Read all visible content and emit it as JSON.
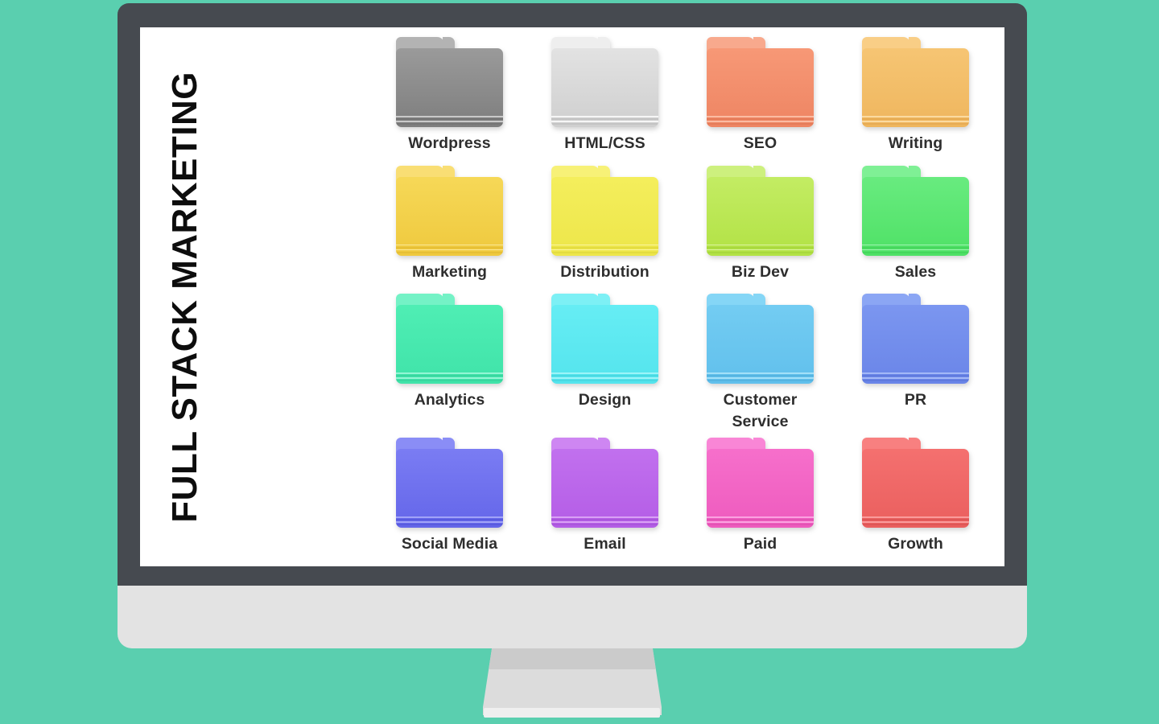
{
  "background_color": "#5ACFAF",
  "monitor": {
    "bezel_color": "#464A50",
    "chin_color": "#E3E3E3",
    "screen_color": "#FFFFFF",
    "stand_color": "#DCDCDC",
    "stand_base_color": "#EFEFEF"
  },
  "title": "FULL STACK MARKETING",
  "desktop": {
    "label_color": "#2E2E2E",
    "columns": 4,
    "rows": 4,
    "folders": [
      {
        "label": "Wordpress",
        "icon": "folder-icon",
        "tab": "#B3B3B3",
        "top": "#9A9A9A",
        "bottom": "#7E7E7E",
        "stripe_light": "#C9C9C9",
        "stripe_dark": "#767676"
      },
      {
        "label": "HTML/CSS",
        "icon": "folder-icon",
        "tab": "#EEEEEE",
        "top": "#E2E2E2",
        "bottom": "#CFCFCF",
        "stripe_light": "#F6F6F6",
        "stripe_dark": "#C4C4C4"
      },
      {
        "label": "SEO",
        "icon": "folder-icon",
        "tab": "#F8A98D",
        "top": "#F79876",
        "bottom": "#EE8563",
        "stripe_light": "#FBBBA2",
        "stripe_dark": "#E57C5A"
      },
      {
        "label": "Writing",
        "icon": "folder-icon",
        "tab": "#F9CE86",
        "top": "#F6C573",
        "bottom": "#EFB65E",
        "stripe_light": "#FBDAA0",
        "stripe_dark": "#E7AC55"
      },
      {
        "label": "Marketing",
        "icon": "folder-icon",
        "tab": "#F9DE74",
        "top": "#F6D857",
        "bottom": "#EFC93E",
        "stripe_light": "#FBE894",
        "stripe_dark": "#E6BF36"
      },
      {
        "label": "Distribution",
        "icon": "folder-icon",
        "tab": "#F7F177",
        "top": "#F4EE5C",
        "bottom": "#EDE64A",
        "stripe_light": "#FAF69C",
        "stripe_dark": "#E3DC41"
      },
      {
        "label": "Biz Dev",
        "icon": "folder-icon",
        "tab": "#CDF07E",
        "top": "#C3EC63",
        "bottom": "#B2E245",
        "stripe_light": "#DBF49D",
        "stripe_dark": "#A8D83E"
      },
      {
        "label": "Sales",
        "icon": "folder-icon",
        "tab": "#7FF095",
        "top": "#68EB7F",
        "bottom": "#4FE166",
        "stripe_light": "#9CF4AE",
        "stripe_dark": "#45D65C"
      },
      {
        "label": "Analytics",
        "icon": "folder-icon",
        "tab": "#74F2C6",
        "top": "#4FEEB4",
        "bottom": "#40E3A9",
        "stripe_light": "#93F6D4",
        "stripe_dark": "#38D79F"
      },
      {
        "label": "Design",
        "icon": "folder-icon",
        "tab": "#7DF0F5",
        "top": "#66EDF4",
        "bottom": "#54E4ED",
        "stripe_light": "#9CF4F8",
        "stripe_dark": "#49D9E2"
      },
      {
        "label": "Customer Service",
        "icon": "folder-icon",
        "tab": "#85D6F6",
        "top": "#73CCF2",
        "bottom": "#61C0EC",
        "stripe_light": "#A2E0F8",
        "stripe_dark": "#55B4E1"
      },
      {
        "label": "PR",
        "icon": "folder-icon",
        "tab": "#8BA6F4",
        "top": "#7B96F0",
        "bottom": "#6A85E8",
        "stripe_light": "#A3B8F7",
        "stripe_dark": "#5F7ADE"
      },
      {
        "label": "Social Media",
        "icon": "folder-icon",
        "tab": "#8A8DF6",
        "top": "#7A7CF3",
        "bottom": "#6466E9",
        "stripe_light": "#A1A3F8",
        "stripe_dark": "#585ADF"
      },
      {
        "label": "Email",
        "icon": "folder-icon",
        "tab": "#CE86F2",
        "top": "#C170EE",
        "bottom": "#B45DE6",
        "stripe_light": "#D9A0F5",
        "stripe_dark": "#AA55DC"
      },
      {
        "label": "Paid",
        "icon": "folder-icon",
        "tab": "#F986D6",
        "top": "#F66FCB",
        "bottom": "#EE5BBE",
        "stripe_light": "#FBA1E0",
        "stripe_dark": "#E452B4"
      },
      {
        "label": "Growth",
        "icon": "folder-icon",
        "tab": "#F88080",
        "top": "#F4706F",
        "bottom": "#EA5F5E",
        "stripe_light": "#FA9B9B",
        "stripe_dark": "#DE5656"
      }
    ]
  }
}
